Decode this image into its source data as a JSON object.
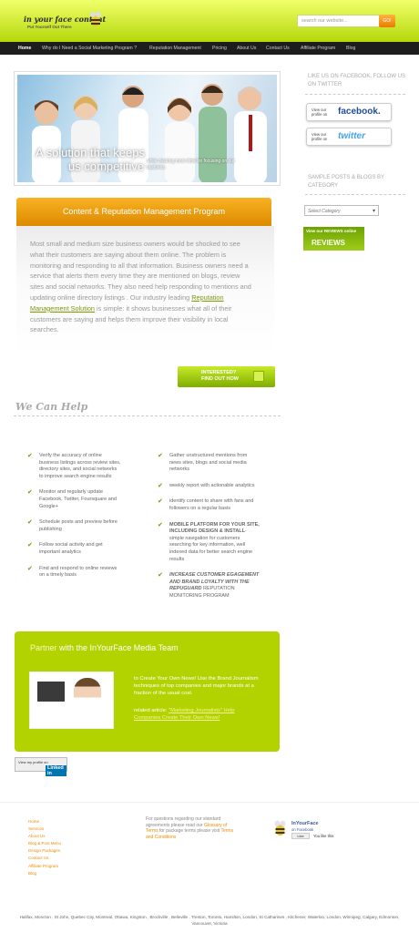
{
  "header": {
    "logo_title": "in your face content",
    "logo_tagline": "Put Yourself Out There",
    "search_placeholder": "search our website...",
    "search_button": "GO!"
  },
  "nav": {
    "items": [
      "Home",
      "Why do I Need a Social Marketing Program ?",
      "Reputation Management",
      "Pricing",
      "About Us",
      "Contact Us",
      "Affiliate Program",
      "Blog"
    ]
  },
  "hero": {
    "line1": "A solution that keeps",
    "line2": "us competitive",
    "small": "while clearing more time for focusing on our business."
  },
  "program": {
    "title": "Content & Reputation Management Program",
    "text_before_link": "Most small and medium size business owners would be shocked to see what their customers are saying about them online. The problem is monitoring and responding to all that information. Business owners need a service that alerts them every time they are mentioned on blogs, review sites and social networks. They also need help responding to mentions and updating online directory listings . Our industry leading ",
    "link": "Reputation Management Solution",
    "text_after_link": " is simple: it shows businesses what all of their customers are saying and helps them improve their visibility in local searches.",
    "cta_line1": "INTERESTED?",
    "cta_line2": "FIND OUT HOW"
  },
  "help": {
    "title": "We Can Help",
    "left": [
      "Verify the accuracy of online business listings across review sites, directory sites, and social networks to improve search engine results",
      "Monitor and regularly update Facebook, Twitter, Foursquare and Google+",
      "Schedule posts and preview before publishing",
      "Follow social activity and get important analytics",
      "Find and respond to online reviews on a timely basis"
    ],
    "right": [
      {
        "bold": "",
        "text": "Gather unstructured mentions from news sites, blogs and social media networks"
      },
      {
        "bold": "",
        "text": "weekly report with actionable analytics"
      },
      {
        "bold": "",
        "text": "identify content to share with fans and followers on a regular basis"
      },
      {
        "bold": "MOBILE PLATFORM FOR YOUR SITE, INCLUDING DESIGN & INSTALL",
        "text": "- simple navigation for customers searching for key information, well indexed data for better search engine results"
      },
      {
        "bold": "INCREASE CUSTOMER EGAGEMENT AND BRAND LOYALTY WITH THE REPUGUARD",
        "text": " REPUTATION MONITORING PROGRAM"
      }
    ]
  },
  "partner": {
    "title_prefix": "Partner",
    "title_rest": " with the InYourFace Media Team",
    "text": "to Create Your Own News! Use the Brand Journalism techniques of top companies and major brands at a fraction of the usual cost.",
    "related_label": "related article: ",
    "related_link": "\"Marketing Journalists\" Help Companies Create Their Own News!"
  },
  "linkedin": {
    "label": "View my profile on",
    "brand": "Linked in"
  },
  "sidebar": {
    "like_title": "LIKE US ON FACEBOOK, FOLLOW US ON TWITTER",
    "view_profile": "View our profile on",
    "facebook": "facebook.",
    "twitter": "twitter",
    "samples_title": "SAMPLE POSTS & BLOGS BY CATEGORY",
    "category_select": "Select Category",
    "reviews_top": "View our REVIEWS online",
    "reviews_big": "REVIEWS"
  },
  "footer": {
    "links": [
      "Home",
      "Services",
      "About Us",
      "Blog & Post Menu",
      "Design Packages",
      "Contact Us",
      "Affiliate Program",
      "Blog"
    ],
    "note_a": "For questions regarding our standard agreements please read our ",
    "note_link1": "Glossary of Terms",
    "note_b": " for package terms please visit ",
    "note_link2": "Terms and Conditions",
    "fb_brand": "InYourFace",
    "fb_on": "on Facebook",
    "fb_like": "Like",
    "fb_likes": "You like this.",
    "cities": "Halifax, Moncton , St John, Quebec City, Montreal, Ottawa, Kingston , Brockville , Belleville , Trenton, Toronto, Hamilton, London, St Catharines , Kitchener, Waterloo, London, Winnipeg, Calgary, Edmonton, Vancouver, Victoria"
  },
  "colors": {
    "accent_green": "#b2d300",
    "accent_orange": "#f08c00",
    "nav_bg": "#1d1d1d"
  }
}
